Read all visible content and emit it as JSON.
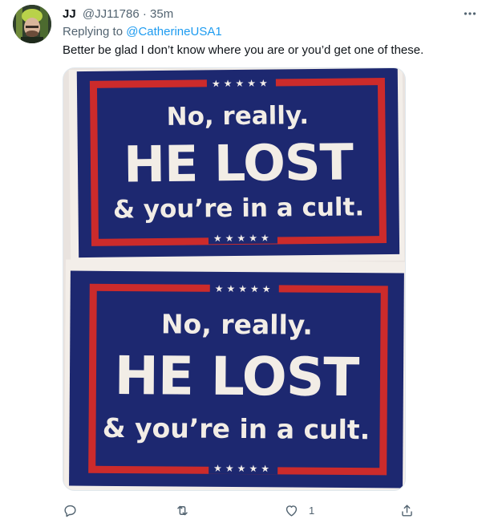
{
  "tweet": {
    "display_name": "JJ",
    "handle": "@JJ11786",
    "separator": "·",
    "time": "35m",
    "replying_prefix": "Replying to",
    "replying_to": "@CatherineUSA1",
    "text": "Better be glad I don’t know where you are or you’d get one of these."
  },
  "media": {
    "signs": [
      {
        "stars": "★★★★★",
        "line1": "No, really.",
        "line2": "HE LOST",
        "line3": "& you’re in a cult.",
        "stars_bottom": "★★★★★"
      },
      {
        "stars": "★★★★★",
        "line1": "No, really.",
        "line2": "HE LOST",
        "line3": "& you’re in a cult.",
        "stars_bottom": "★★★★★"
      }
    ]
  },
  "actions": {
    "reply_count": "",
    "retweet_count": "",
    "like_count": "1",
    "share_count": ""
  },
  "colors": {
    "link": "#1d9bf0",
    "secondary_text": "#536471",
    "sign_blue": "#1d2870",
    "sign_red": "#cc2b2b",
    "sign_cream": "#f3eee9"
  },
  "icons": {
    "more": "more-dots-icon",
    "reply": "reply-bubble-icon",
    "retweet": "retweet-icon",
    "like": "heart-icon",
    "share": "share-upload-icon"
  }
}
